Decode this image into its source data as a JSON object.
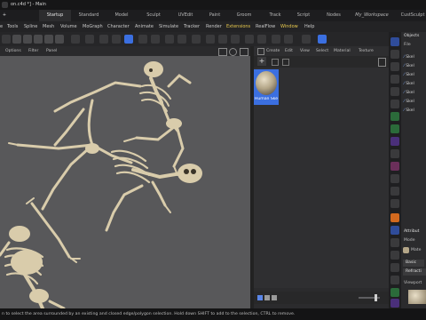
{
  "window": {
    "title": "on.c4d *] - Main"
  },
  "layout_tabs": [
    "Startup",
    "Standard",
    "Model",
    "Sculpt",
    "UVEdit",
    "Paint",
    "Groom",
    "Track",
    "Script",
    "Nodes",
    "My_Workspace",
    "CustSculpt"
  ],
  "menubar": [
    "Tools",
    "Spline",
    "Mesh",
    "Volume",
    "MoGraph",
    "Character",
    "Animate",
    "Simulate",
    "Tracker",
    "Render",
    "Extensions",
    "RealFlow",
    "Window",
    "Help"
  ],
  "viewport_menu": [
    "Options",
    "Filter",
    "Panel"
  ],
  "material_menu": [
    "Create",
    "Edit",
    "View",
    "Select",
    "Material",
    "Texture"
  ],
  "material": {
    "name": "Human Ske"
  },
  "objects": {
    "title": "Objects",
    "menu_first": "File",
    "rows": [
      "Skel",
      "Skel",
      "Skel",
      "Skel",
      "Skel",
      "Skel",
      "Skel"
    ]
  },
  "attributes": {
    "title": "Attribut",
    "mode": "Mode",
    "material_label": "Mate",
    "tab_basic": "Basic",
    "tab_refraction": "Refracti",
    "viewport": "Viewport"
  },
  "statusbar": {
    "text": "n to select the area surrounded by an existing and closed edge/polygon selection. Hold down SHIFT to add to the selection, CTRL to remove."
  },
  "colors": {
    "accent_blue": "#3b6fe0",
    "highlight": "#e8c94d",
    "bone": "#d9ccab",
    "viewport_bg": "#58585a"
  }
}
